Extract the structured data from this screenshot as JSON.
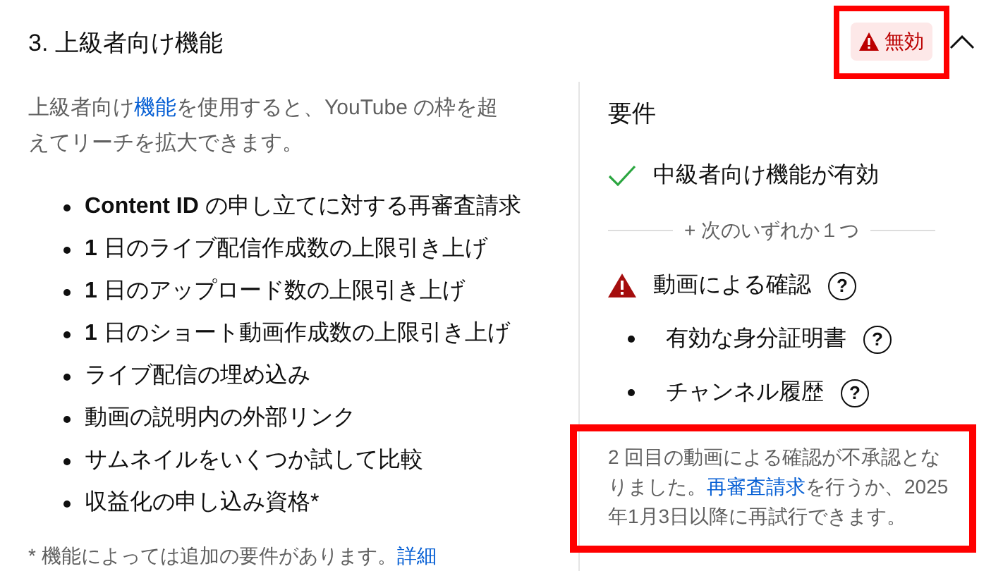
{
  "section": {
    "title": "3. 上級者向け機能",
    "status": {
      "label": "無効",
      "kind": "error",
      "highlighted": true
    },
    "expanded": true
  },
  "description": {
    "before": "上級者向け",
    "link": "機能",
    "after": "を使用すると、YouTube の枠を超えてリーチを拡大できます。"
  },
  "features": [
    {
      "text": "**Content ID** の申し立てに対する再審査請求"
    },
    {
      "text": "**1** 日のライブ配信作成数の上限引き上げ"
    },
    {
      "text": "**1** 日のアップロード数の上限引き上げ"
    },
    {
      "text": "**1** 日のショート動画作成数の上限引き上げ"
    },
    {
      "text": "ライブ配信の埋め込み"
    },
    {
      "text": "動画の説明内の外部リンク"
    },
    {
      "text": "サムネイルをいくつか試して比較"
    },
    {
      "text": "収益化の申し込み資格*"
    }
  ],
  "footnote": {
    "text": "* 機能によっては追加の要件があります。",
    "link": "詳細"
  },
  "requirements": {
    "title": "要件",
    "items": [
      {
        "kind": "met",
        "text": "中級者向け機能が有効"
      },
      {
        "kind": "divider",
        "text": "+ 次のいずれか１つ"
      },
      {
        "kind": "failed",
        "text": "動画による確認",
        "help": "?"
      },
      {
        "kind": "option",
        "text": "有効な身分証明書",
        "help": "?"
      },
      {
        "kind": "option",
        "text": "チャンネル履歴",
        "help": "?"
      }
    ],
    "note": {
      "before": "2 回目の動画による確認が不承認となりました。",
      "link": "再審査請求",
      "after": "を行うか、2025年1月3日以降に再試行できます。",
      "highlighted": true
    }
  }
}
